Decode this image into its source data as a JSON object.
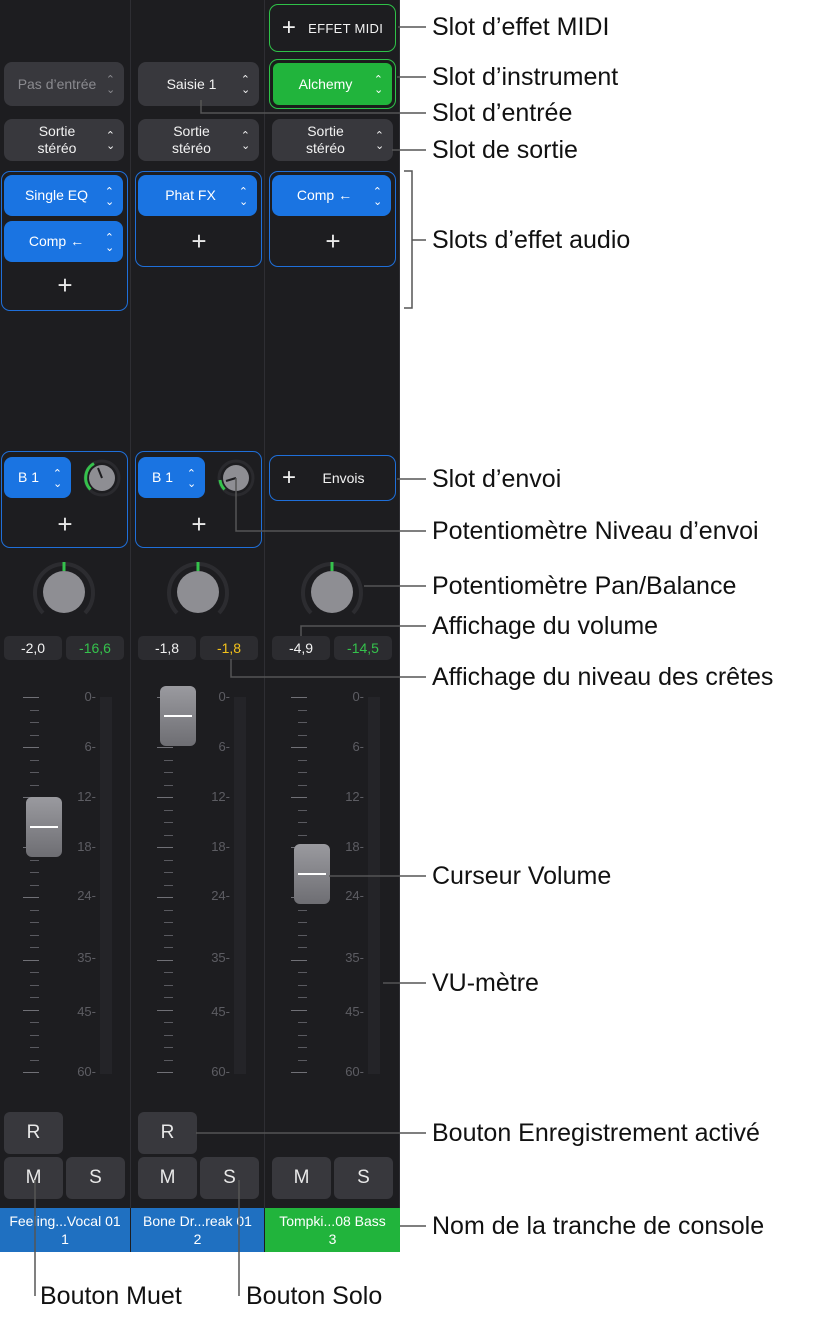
{
  "strips": [
    {
      "midi_fx": null,
      "input": "Pas d’entrée",
      "instrument": null,
      "output": [
        "Sortie",
        "stéréo"
      ],
      "audio_fx": [
        "Single EQ",
        "Comp ←"
      ],
      "send": {
        "label": "B 1",
        "level_fraction": 0.55
      },
      "volume": "-2,0",
      "peak": "-16,6",
      "record": "R",
      "mute": "M",
      "solo": "S",
      "name": [
        "Feeling...Vocal 01",
        "1"
      ]
    },
    {
      "input": "Saisie 1",
      "output": [
        "Sortie",
        "stéréo"
      ],
      "audio_fx": [
        "Phat FX"
      ],
      "send": {
        "label": "B 1",
        "level_fraction": 0.15
      },
      "volume": "-1,8",
      "peak": "-1,8",
      "record": "R",
      "mute": "M",
      "solo": "S",
      "name": [
        "Bone Dr...reak 01",
        "2"
      ]
    },
    {
      "midi_fx": "EFFET MIDI",
      "instrument": "Alchemy",
      "output": [
        "Sortie",
        "stéréo"
      ],
      "audio_fx": [
        "Comp ←"
      ],
      "send_slot": "Envois",
      "volume": "-4,9",
      "peak": "-14,5",
      "mute": "M",
      "solo": "S",
      "name": [
        "Tompki...08 Bass",
        "3"
      ]
    }
  ],
  "scale_labels": [
    "0-",
    "6-",
    "12-",
    "18-",
    "24-",
    "35-",
    "45-",
    "60-"
  ],
  "annotations": [
    "Slot d’effet MIDI",
    "Slot d’instrument",
    "Slot d’entrée",
    "Slot de sortie",
    "Slots d’effet audio",
    "Slot d’envoi",
    "Potentiomètre Niveau d’envoi",
    "Potentiomètre Pan/Balance",
    "Affichage du volume",
    "Affichage du niveau des crêtes",
    "Curseur Volume",
    "VU-mètre",
    "Bouton Enregistrement activé",
    "Nom de la tranche de console",
    "Bouton Muet",
    "Bouton Solo"
  ],
  "colors": {
    "background": "#1d1d20",
    "button": "#38383d",
    "blue": "#1a74e2",
    "green": "#21b43c",
    "peak_green": "#35c24c",
    "peak_yellow": "#f3c21b",
    "name_blue": "#1f70c1",
    "name_green": "#21b43c"
  }
}
